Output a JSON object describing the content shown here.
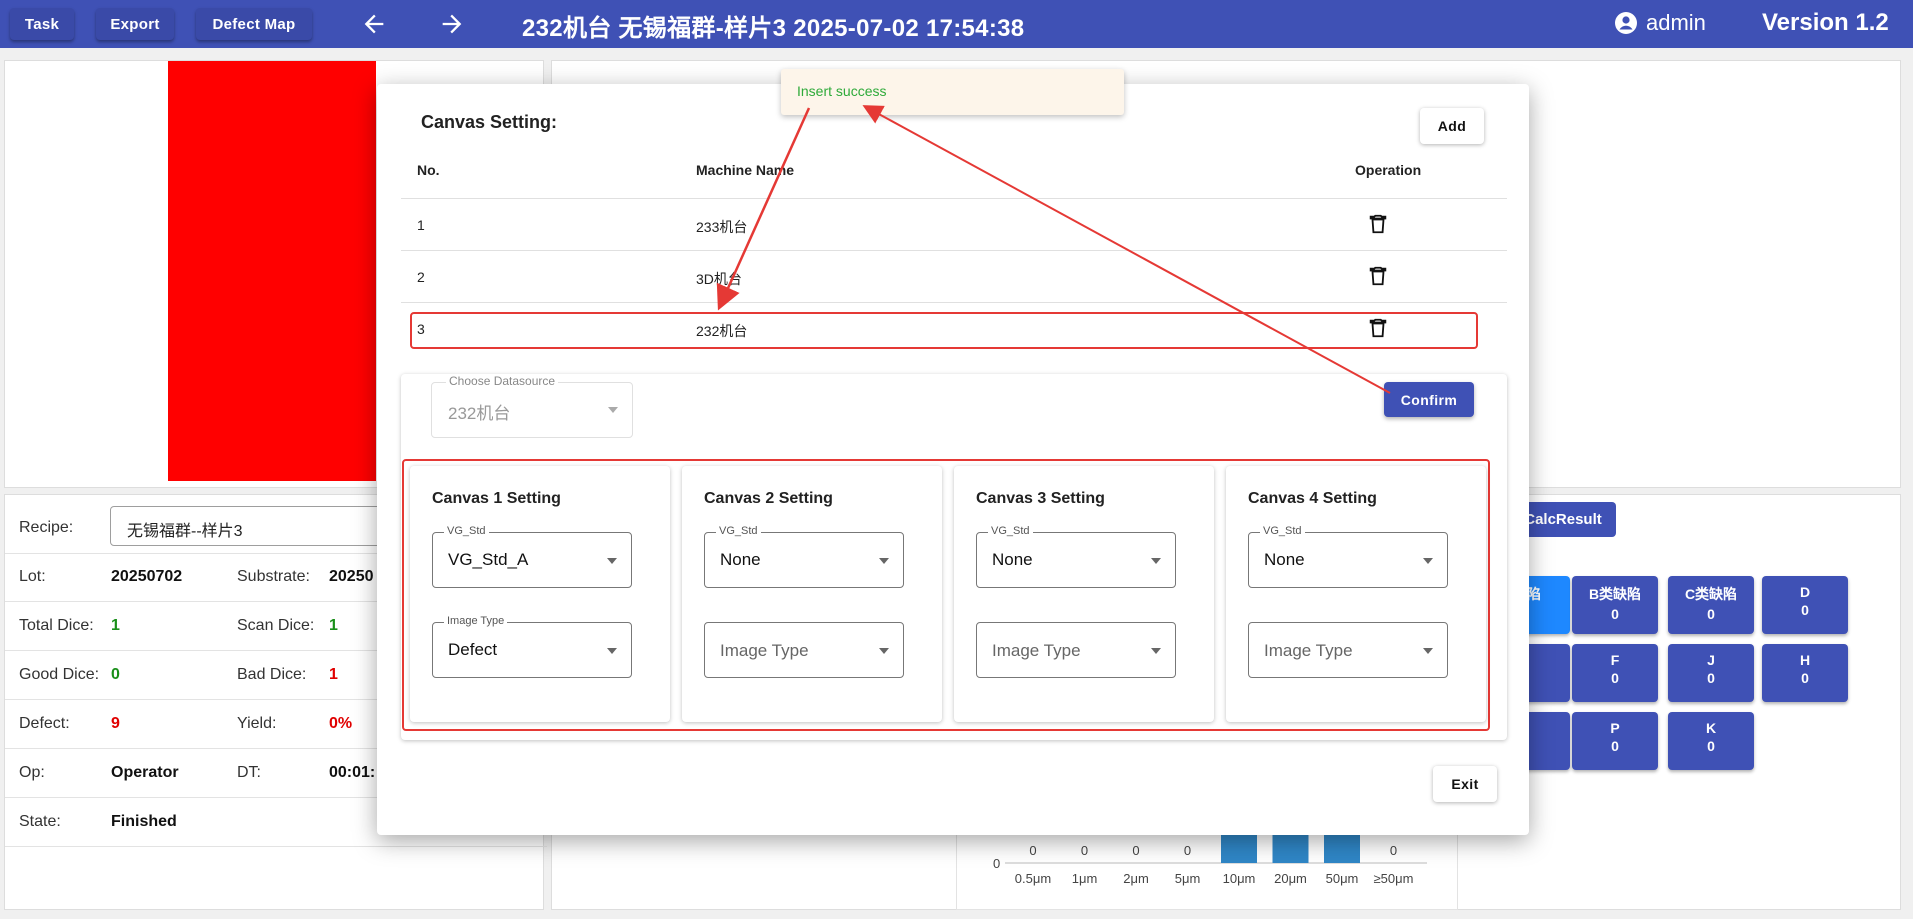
{
  "topbar": {
    "task_label": "Task",
    "export_label": "Export",
    "defect_map_label": "Defect Map",
    "title": "232机台   无锡福群-样片3   2025-07-02 17:54:38",
    "user": "admin",
    "version": "Version 1.2"
  },
  "info": {
    "recipe_label": "Recipe:",
    "recipe_value": "无锡福群--样片3",
    "lot_label": "Lot:",
    "lot_value": "20250702",
    "substrate_label": "Substrate:",
    "substrate_value": "20250",
    "total_dice_label": "Total Dice:",
    "total_dice_value": "1",
    "scan_dice_label": "Scan Dice:",
    "scan_dice_value": "1",
    "good_dice_label": "Good Dice:",
    "good_dice_value": "0",
    "bad_dice_label": "Bad Dice:",
    "bad_dice_value": "1",
    "defect_label": "Defect:",
    "defect_value": "9",
    "yield_label": "Yield:",
    "yield_value": "0%",
    "op_label": "Op:",
    "op_value": "Operator",
    "dt_label": "DT:",
    "dt_value": "00:01:",
    "state_label": "State:",
    "state_value": "Finished"
  },
  "calc_result_label": "CalcResult",
  "defect_tiles": [
    {
      "name": "缺陷",
      "count": ""
    },
    {
      "name": "B类缺陷",
      "count": "0"
    },
    {
      "name": "C类缺陷",
      "count": "0"
    },
    {
      "name": "D",
      "count": "0"
    },
    {
      "name": "F",
      "count": "0"
    },
    {
      "name": "J",
      "count": "0"
    },
    {
      "name": "H",
      "count": "0"
    },
    {
      "name": "P",
      "count": "0"
    },
    {
      "name": "K",
      "count": "0"
    }
  ],
  "chart_data": {
    "type": "bar",
    "categories": [
      "0.5μm",
      "1μm",
      "2μm",
      "5μm",
      "10μm",
      "20μm",
      "50μm",
      "≥50μm"
    ],
    "values": [
      0,
      0,
      0,
      0,
      null,
      null,
      null,
      0
    ],
    "value_labels": [
      "0",
      "0",
      "0",
      "0",
      "",
      "",
      "",
      "0"
    ],
    "y_tick": "0",
    "bar_color": "#2f86c6"
  },
  "dialog": {
    "title": "Canvas Setting:",
    "add_label": "Add",
    "columns": {
      "no": "No.",
      "machine": "Machine Name",
      "operation": "Operation"
    },
    "rows": [
      {
        "no": "1",
        "machine": "233机台"
      },
      {
        "no": "2",
        "machine": "3D机台"
      },
      {
        "no": "3",
        "machine": "232机台"
      }
    ],
    "datasource": {
      "label": "Choose Datasource",
      "value": "232机台"
    },
    "confirm_label": "Confirm",
    "exit_label": "Exit",
    "canvases": [
      {
        "title": "Canvas 1 Setting",
        "vg_label": "VG_Std",
        "vg_value": "VG_Std_A",
        "image_label": "Image Type",
        "image_value": "Defect"
      },
      {
        "title": "Canvas 2 Setting",
        "vg_label": "VG_Std",
        "vg_value": "None",
        "image_placeholder": "Image Type"
      },
      {
        "title": "Canvas 3 Setting",
        "vg_label": "VG_Std",
        "vg_value": "None",
        "image_placeholder": "Image Type"
      },
      {
        "title": "Canvas 4 Setting",
        "vg_label": "VG_Std",
        "vg_value": "None",
        "image_placeholder": "Image Type"
      }
    ]
  },
  "toast": {
    "message": "Insert success"
  },
  "colors": {
    "primary": "#3f51b5",
    "highlight": "#e53935",
    "success": "#2eaa3a"
  }
}
